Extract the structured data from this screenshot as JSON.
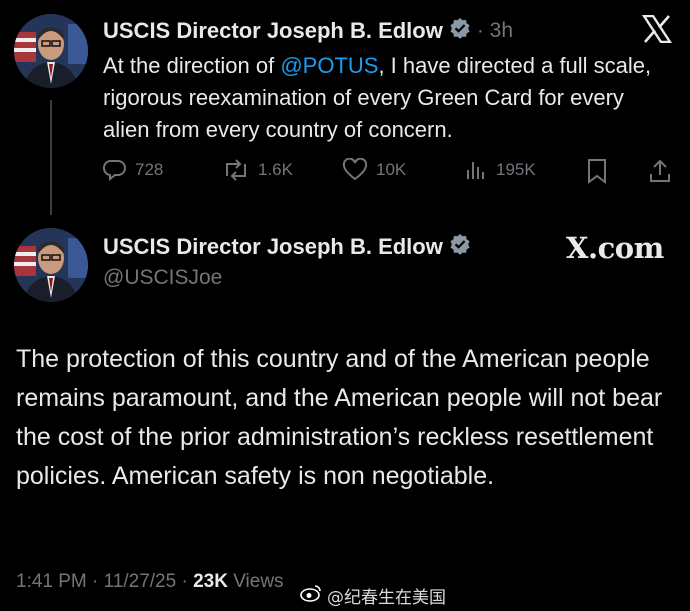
{
  "reply_tweet": {
    "author_name": "USCIS Director Joseph B. Edlow",
    "time": "· 3h",
    "text_before_mention": "At the direction of ",
    "mention": "@POTUS",
    "text_after_mention": ", I have directed a full scale, rigorous reexamination of every Green Card for every alien from every country of concern.",
    "actions": {
      "replies": "728",
      "reposts": "1.6K",
      "likes": "10K",
      "views": "195K"
    }
  },
  "main_tweet": {
    "author_name": "USCIS Director Joseph B. Edlow",
    "handle": "@USCISJoe",
    "site_label": "X.com",
    "text": "The protection of this country and of the American people remains paramount, and the American people will not bear the cost of the prior administration’s reckless resettlement policies. American safety is non negotiable.",
    "timestamp": "1:41 PM · 11/27/25 · ",
    "views_count": "23K",
    "views_label": " Views"
  },
  "watermark": {
    "text": "@纪春生在美国"
  },
  "colors": {
    "background": "#000000",
    "text": "#e7e9ea",
    "muted": "#71767b",
    "accent": "#1d9bf0"
  },
  "icons": [
    "x-logo-icon",
    "verified-badge-icon",
    "reply-icon",
    "repost-icon",
    "like-icon",
    "views-icon",
    "bookmark-icon",
    "share-icon",
    "weibo-icon"
  ]
}
